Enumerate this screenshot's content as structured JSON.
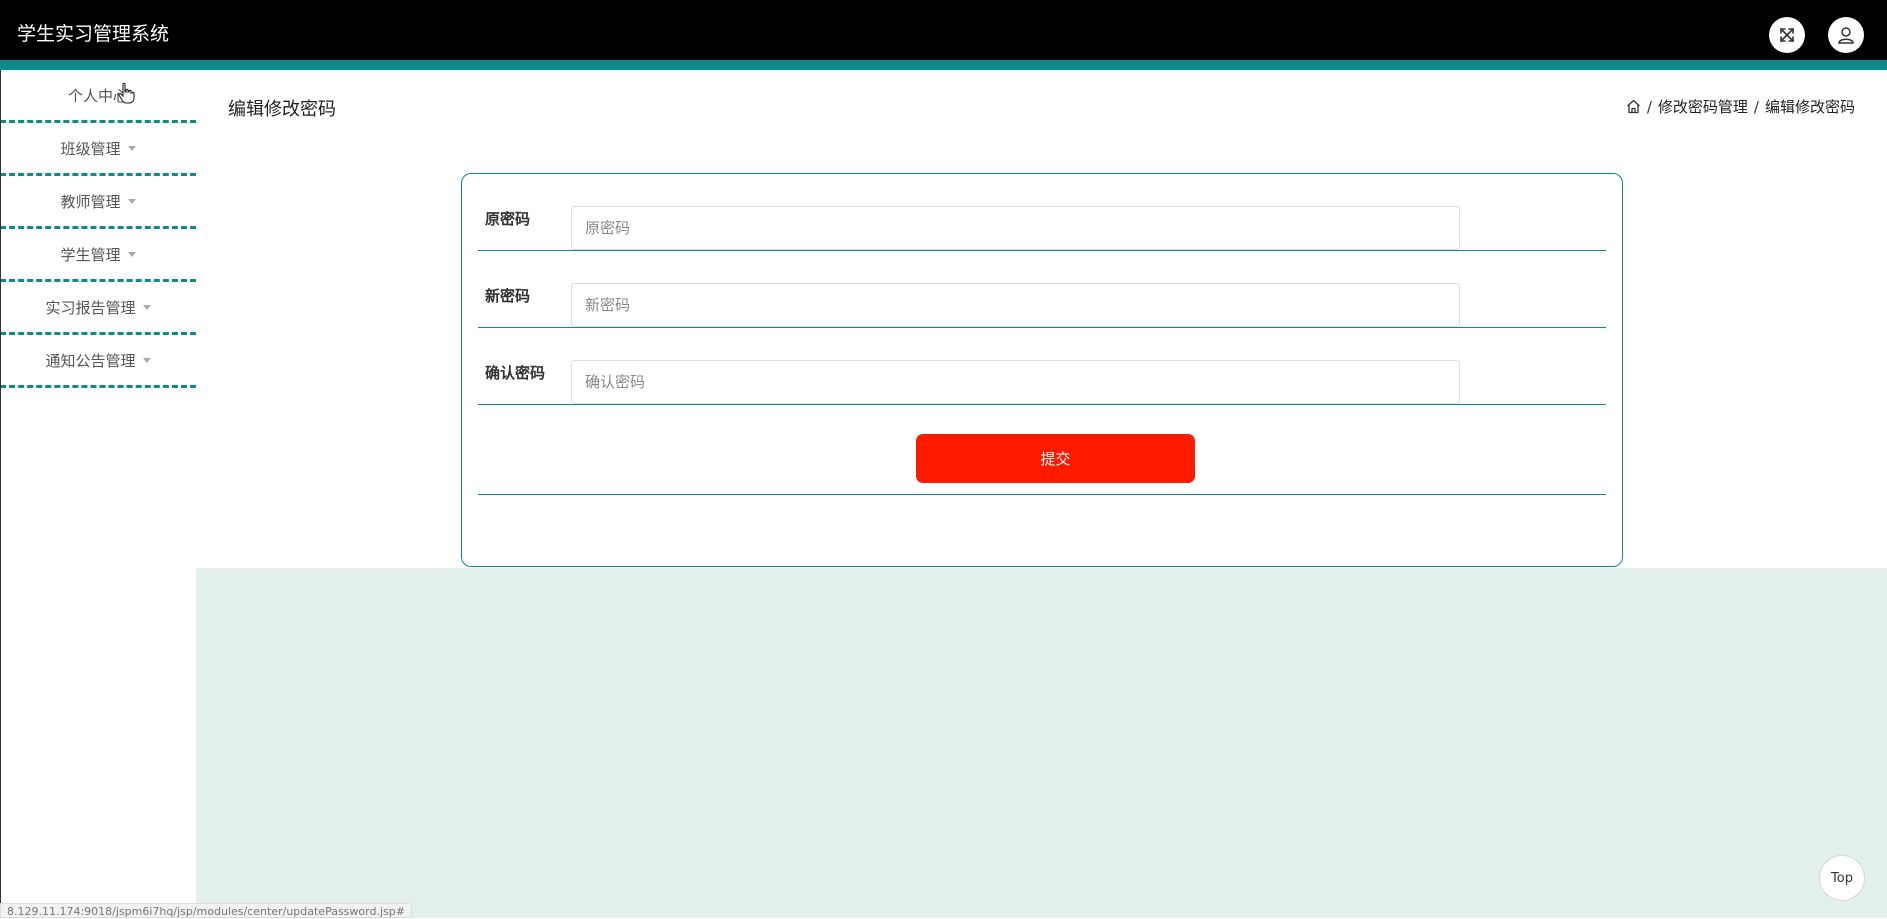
{
  "header": {
    "app_title": "学生实习管理系统",
    "fullscreen_icon": "fullscreen-icon",
    "user_icon": "user-icon",
    "accent_color": "#0f8a8a"
  },
  "sidebar": {
    "items": [
      {
        "label": "个人中心",
        "has_caret": false
      },
      {
        "label": "班级管理",
        "has_caret": true
      },
      {
        "label": "教师管理",
        "has_caret": true
      },
      {
        "label": "学生管理",
        "has_caret": true
      },
      {
        "label": "实习报告管理",
        "has_caret": true
      },
      {
        "label": "通知公告管理",
        "has_caret": true
      }
    ]
  },
  "main": {
    "page_title": "编辑修改密码",
    "breadcrumb": {
      "home_icon": "home-icon",
      "items": [
        "修改密码管理",
        "编辑修改密码"
      ],
      "separator": "/"
    },
    "form": {
      "fields": [
        {
          "label": "原密码",
          "placeholder": "原密码",
          "value": ""
        },
        {
          "label": "新密码",
          "placeholder": "新密码",
          "value": ""
        },
        {
          "label": "确认密码",
          "placeholder": "确认密码",
          "value": ""
        }
      ],
      "submit_label": "提交",
      "submit_color": "#ff1a00"
    }
  },
  "status_url": "8.129.11.174:9018/jspm6i7hq/jsp/modules/center/updatePassword.jsp#",
  "top_button_label": "Top"
}
